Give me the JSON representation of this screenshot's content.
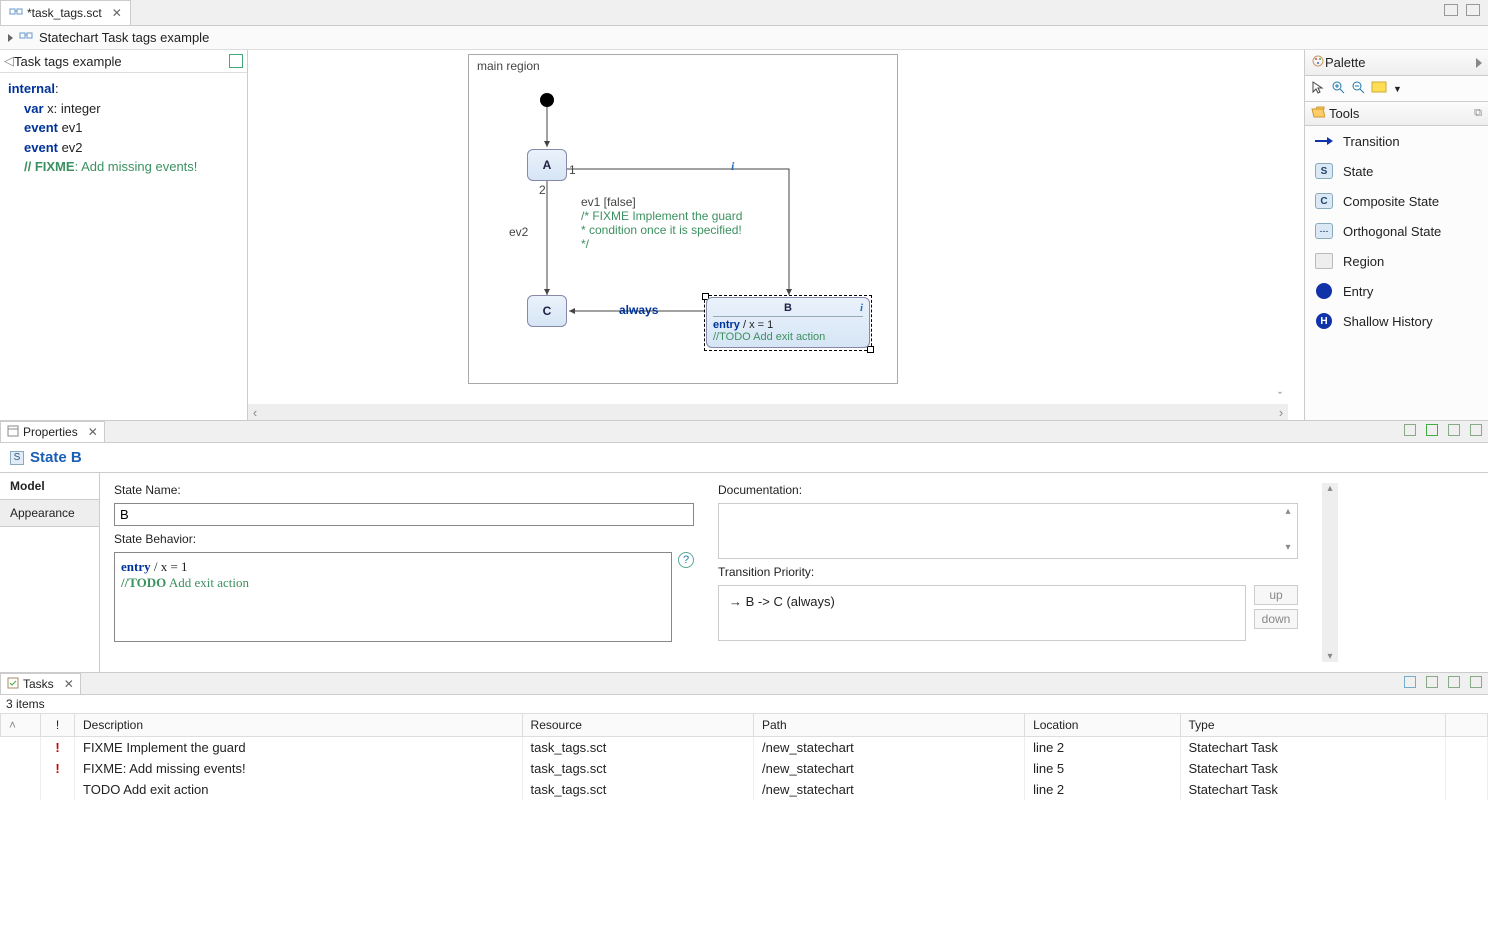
{
  "tab": {
    "title": "*task_tags.sct"
  },
  "breadcrumb": "Statechart Task tags example",
  "defPane": {
    "title": "Task tags example",
    "lines": {
      "internal": "internal",
      "var": "var",
      "var_rest": " x: integer",
      "event": "event",
      "ev1": " ev1",
      "ev2": " ev2",
      "fixme_kw": "// FIXME",
      "fixme_rest": ": Add missing events!"
    }
  },
  "region": {
    "label": "main region"
  },
  "states": {
    "A": "A",
    "B": "B",
    "C": "C"
  },
  "stateB_entry_kw": "entry",
  "stateB_entry_rest": " / x = 1",
  "stateB_todo": "//TODO Add exit action",
  "tr": {
    "n1": "1",
    "n2": "2",
    "ev2": "ev2",
    "ev1_guard": "ev1 [false]",
    "fixme1": "/* FIXME Implement the guard",
    "fixme2": " * condition once it is specified!",
    "fixme3": " */",
    "always": "always",
    "i": "i"
  },
  "palette": {
    "title": "Palette",
    "tools": "Tools",
    "items": [
      "Transition",
      "State",
      "Composite State",
      "Orthogonal State",
      "Region",
      "Entry",
      "Shallow History"
    ]
  },
  "propsView": {
    "tabTitle": "Properties"
  },
  "props": {
    "heading": "State B",
    "tabs": {
      "model": "Model",
      "appearance": "Appearance"
    },
    "nameLabel": "State Name:",
    "nameValue": "B",
    "behavLabel": "State Behavior:",
    "behav_entry_kw": "entry",
    "behav_entry_rest": " / x = 1",
    "behav_todo_kw": "//TODO",
    "behav_todo_rest": " Add exit action",
    "docLabel": "Documentation:",
    "prioLabel": "Transition Priority:",
    "prioItem": "B -> C (always)",
    "up": "up",
    "down": "down"
  },
  "tasksView": {
    "tabTitle": "Tasks",
    "count": "3 items"
  },
  "tasks": {
    "cols": {
      "c1": "",
      "c2": "!",
      "desc": "Description",
      "res": "Resource",
      "path": "Path",
      "loc": "Location",
      "type": "Type"
    },
    "rows": [
      {
        "pri": "!",
        "desc": "FIXME Implement the guard",
        "res": "task_tags.sct",
        "path": "/new_statechart",
        "loc": "line 2",
        "type": "Statechart Task"
      },
      {
        "pri": "!",
        "desc": "FIXME: Add missing events!",
        "res": "task_tags.sct",
        "path": "/new_statechart",
        "loc": "line 5",
        "type": "Statechart Task"
      },
      {
        "pri": "",
        "desc": "TODO Add exit action",
        "res": "task_tags.sct",
        "path": "/new_statechart",
        "loc": "line 2",
        "type": "Statechart Task"
      }
    ]
  }
}
